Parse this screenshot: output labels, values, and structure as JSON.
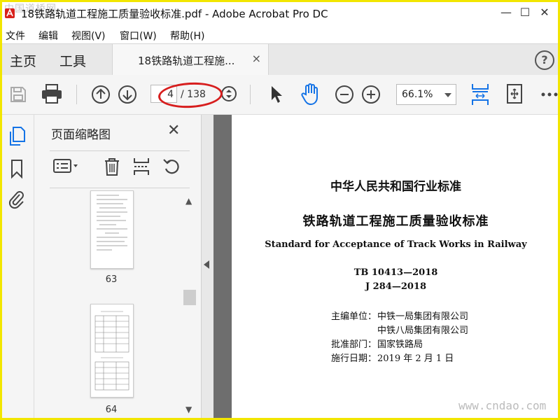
{
  "window": {
    "watermark_tl": "中国道桥网",
    "title": "18铁路轨道工程施工质量验收标准.pdf - Adobe Acrobat Pro DC",
    "min": "—",
    "max": "☐",
    "close": "✕"
  },
  "menu": [
    "文件",
    "编辑",
    "视图(V)",
    "窗口(W)",
    "帮助(H)"
  ],
  "tabs": {
    "home": "主页",
    "tools": "工具",
    "doc_tab": "18铁路轨道工程施...",
    "doc_close": "×",
    "help": "?"
  },
  "toolbar": {
    "current_page": "4",
    "total_pages": "/ 138",
    "zoom": "66.1%"
  },
  "colors": {
    "accent": "#1473e6",
    "annotation_circle": "#d71e1e",
    "frame": "#f2e600"
  },
  "thumbnail_panel": {
    "title": "页面缩略图",
    "close": "✕",
    "pages": [
      {
        "label": "63"
      },
      {
        "label": "64"
      }
    ],
    "scroll_up": "▲",
    "scroll_down": "▼"
  },
  "document": {
    "header": "中华人民共和国行业标准",
    "title_cn": "铁路轨道工程施工质量验收标准",
    "title_en": "Standard for Acceptance of Track Works in Railway",
    "code1": "TB 10413—2018",
    "code2": "J 284—2018",
    "editor_label": "主编单位：",
    "editor1": "中铁一局集团有限公司",
    "editor2": "中铁八局集团有限公司",
    "approval_label": "批准部门：",
    "approval": "国家铁路局",
    "effective_label": "施行日期：",
    "effective": "2019 年 2 月 1 日"
  },
  "watermark_br": "www.cndao.com"
}
